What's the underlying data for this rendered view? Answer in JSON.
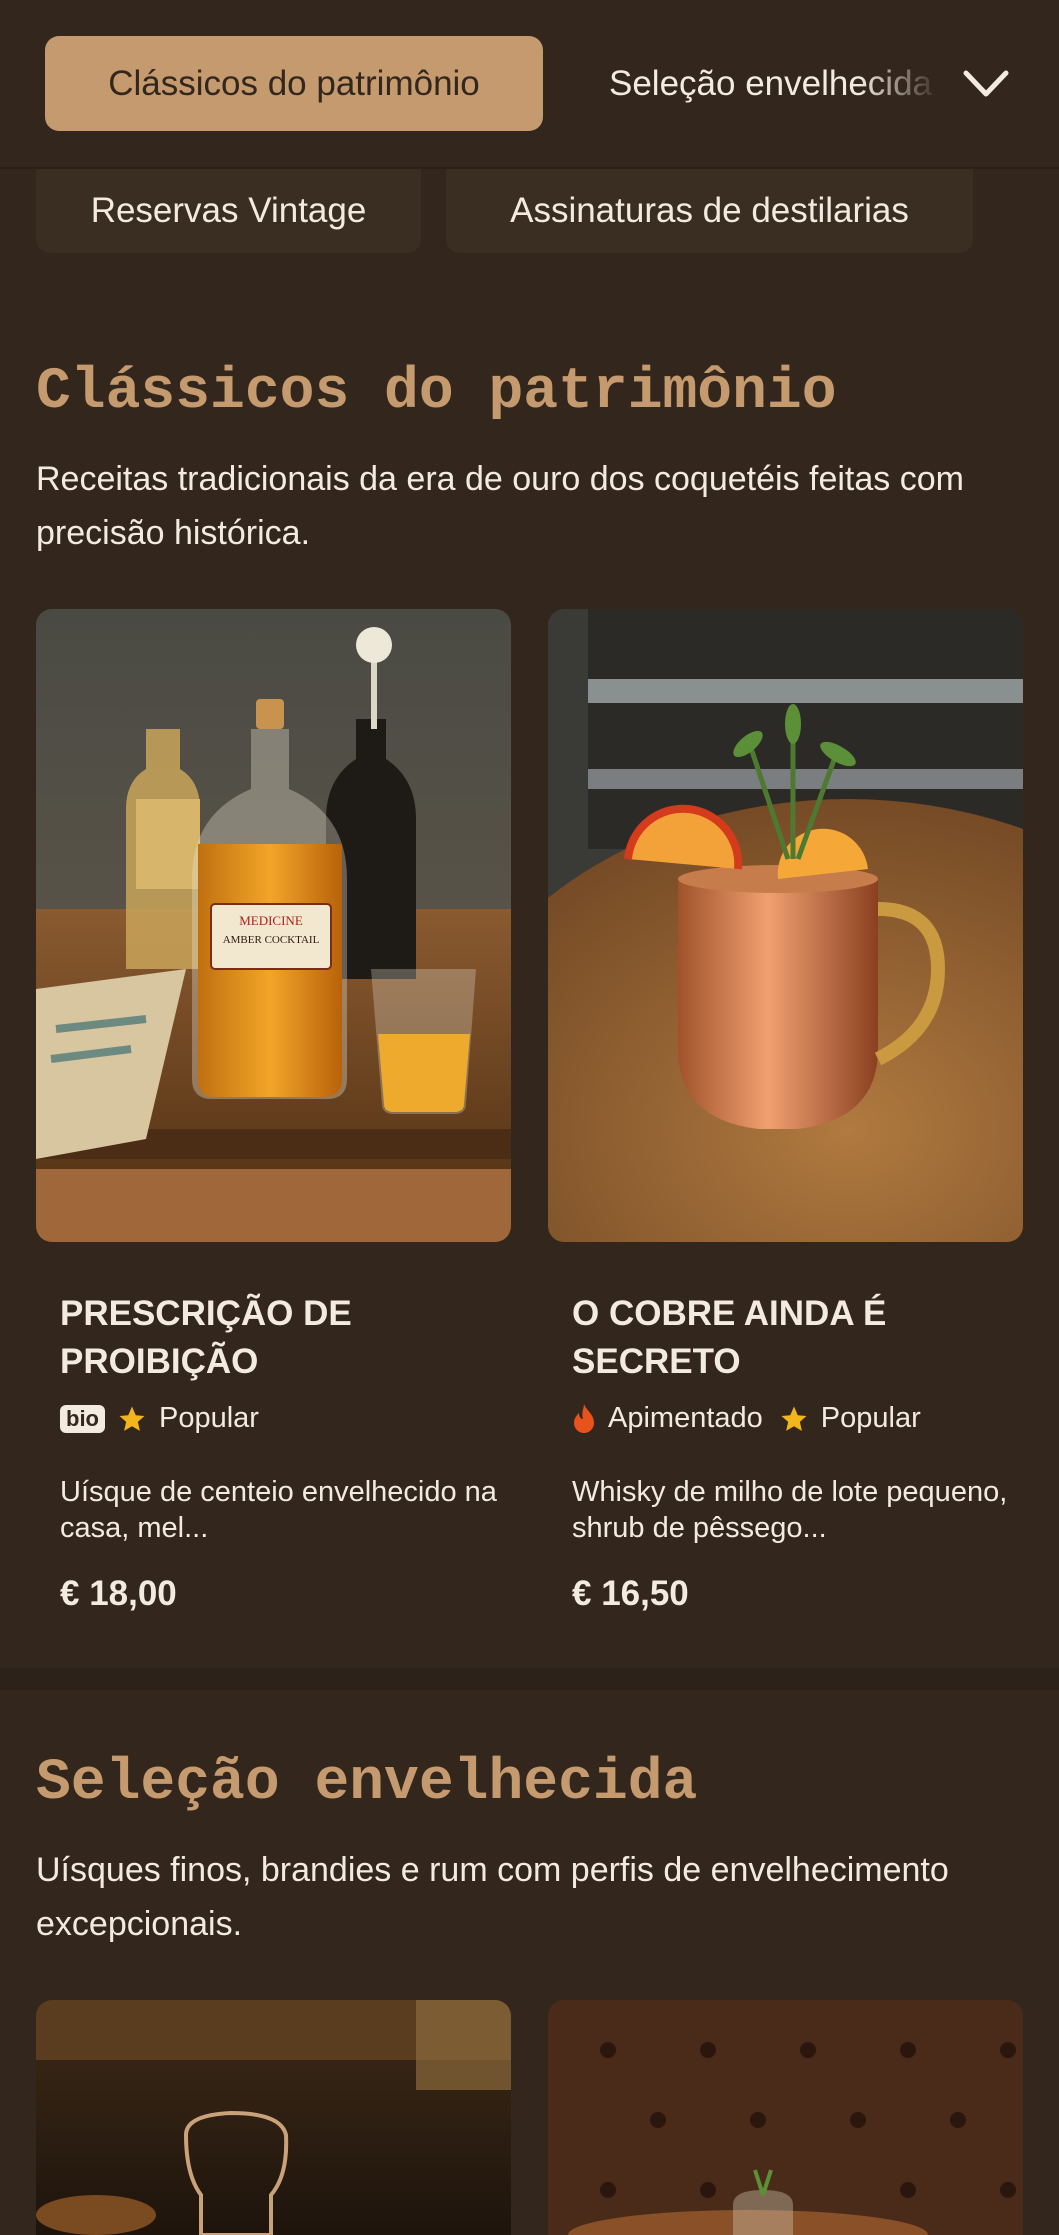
{
  "categories": {
    "active": "Clássicos do patrimônio",
    "next": "Seleção envelhecida",
    "row2": [
      "Reservas Vintage",
      "Assinaturas de destilarias"
    ]
  },
  "sections": [
    {
      "title": "Clássicos do patrimônio",
      "description": "Receitas tradicionais da era de ouro dos coquetéis feitas com precisão histórica.",
      "items": [
        {
          "name": "PRESCRIÇÃO DE PROIBIÇÃO",
          "badge": "bio",
          "tag": "Popular",
          "description": "Uísque de centeio envelhecido na casa, mel...",
          "price": "€ 18,00",
          "label_line1": "MEDICINE",
          "label_line2": "AMBER COCKTAIL"
        },
        {
          "name": "O COBRE AINDA É SECRETO",
          "tag1": "Apimentado",
          "tag2": "Popular",
          "description": "Whisky de milho de lote pequeno, shrub de pêssego...",
          "price": "€ 16,50"
        }
      ]
    },
    {
      "title": "Seleção envelhecida",
      "description": "Uísques finos, brandies e rum com perfis de envelhecimento excepcionais."
    }
  ],
  "icons": {
    "chevron": "chevron-down-icon",
    "star": "star-icon",
    "flame": "flame-icon"
  },
  "colors": {
    "background": "#33271d",
    "accent": "#c49a6e",
    "text": "#f3ebe0",
    "star": "#f2b51c",
    "flame": "#e8521c"
  }
}
